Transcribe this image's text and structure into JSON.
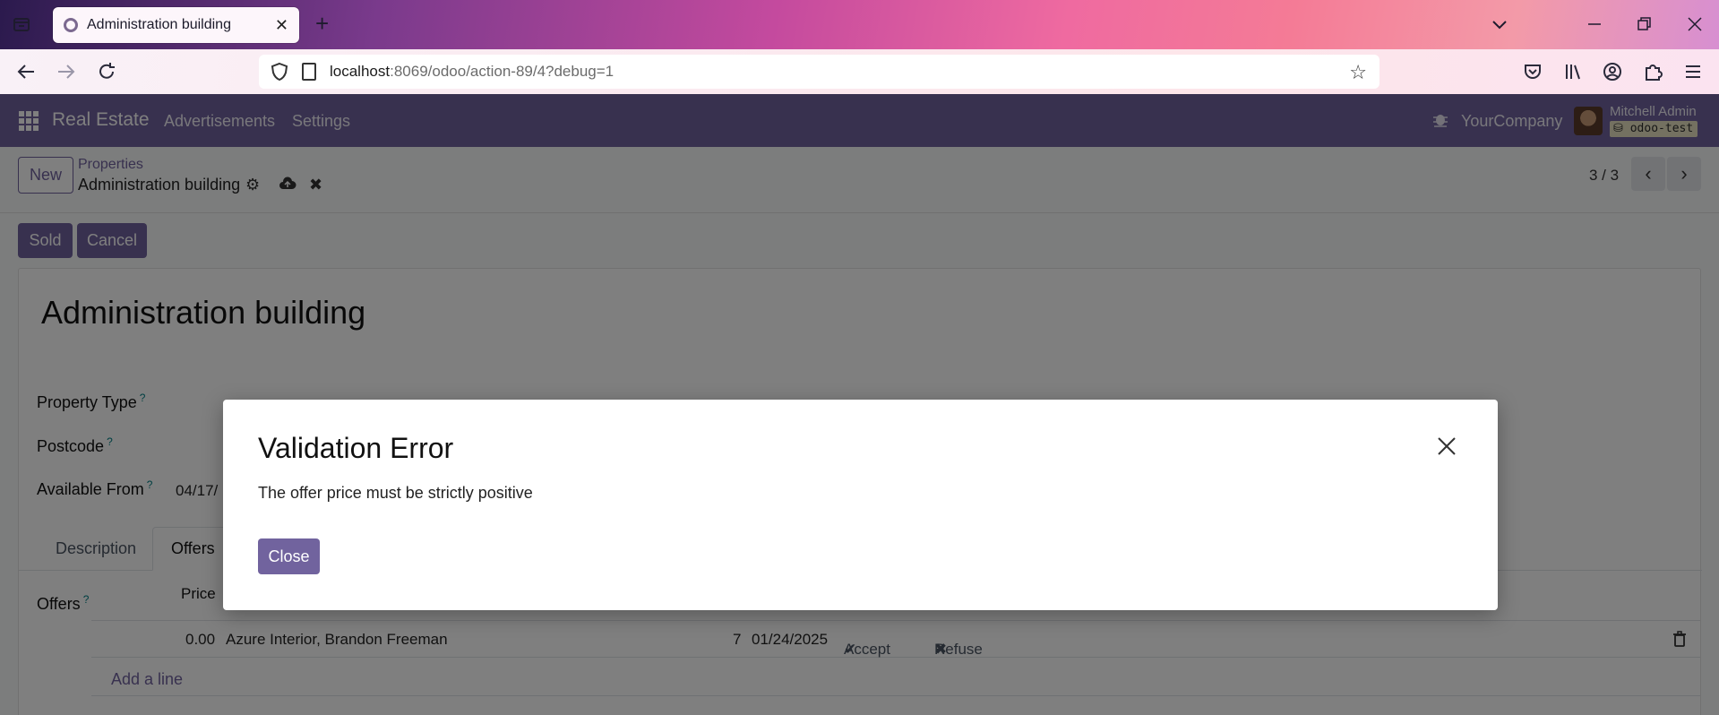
{
  "browser": {
    "tab_title": "Administration building",
    "url_host": "localhost",
    "url_rest": ":8069/odoo/action-89/4?debug=1"
  },
  "topnav": {
    "app_name": "Real Estate",
    "menu": [
      "Advertisements",
      "Settings"
    ],
    "company": "YourCompany",
    "user": "Mitchell Admin",
    "database": "odoo-test"
  },
  "control": {
    "new_label": "New",
    "breadcrumb": "Properties",
    "record_title": "Administration building",
    "pager": "3 / 3",
    "status_buttons": [
      "Sold",
      "Cancel"
    ]
  },
  "form": {
    "title": "Administration building",
    "fields": {
      "property_type": "Property Type",
      "postcode": "Postcode",
      "available_from": "Available From",
      "available_from_value": "04/17/",
      "help_mark": "?"
    },
    "tabs": [
      "Description",
      "Offers"
    ],
    "offers_label": "Offers",
    "offers_header_price": "Price",
    "offer_row": {
      "price": "0.00",
      "partner": "Azure Interior, Brandon Freeman",
      "validity": "7",
      "deadline": "01/24/2025",
      "accept": "Accept",
      "refuse": "Refuse"
    },
    "add_line": "Add a line"
  },
  "modal": {
    "title": "Validation Error",
    "message": "The offer price must be strictly positive",
    "close_label": "Close"
  },
  "colors": {
    "brand": "#71639e",
    "help": "#017e84"
  }
}
